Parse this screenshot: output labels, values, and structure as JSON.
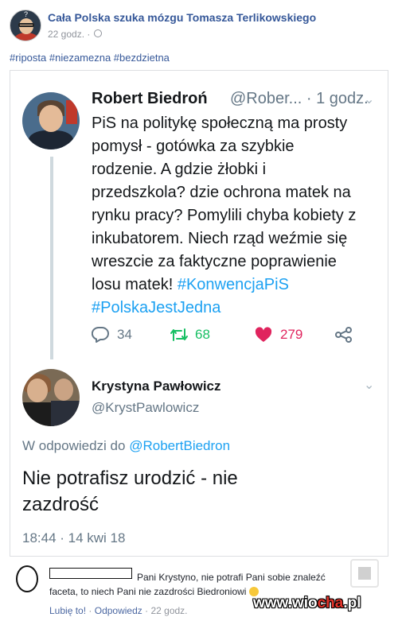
{
  "post": {
    "page_name": "Cała Polska szuka mózgu Tomasza Terlikowskiego",
    "time": "22 godz. ·",
    "hashtags": "#riposta #niezamezna #bezdzietna"
  },
  "tweet1": {
    "name": "Robert Biedroń",
    "handle": "@Rober... · 1 godz.",
    "text_lines": [
      "PiS na politykę społeczną ma prosty",
      "pomysł - gotówka za szybkie",
      "rodzenie. A gdzie żłobki i",
      "przedszkola? dzie ochrona matek na",
      "rynku pracy? Pomylili chyba kobiety z",
      "inkubatorem. Niech rząd weźmie się",
      "wreszcie za faktyczne poprawienie",
      "losu matek!"
    ],
    "hashtag1": "#KonwencjaPiS",
    "hashtag2": "#PolskaJestJedna",
    "replies": "34",
    "retweets": "68",
    "likes": "279",
    "colors": {
      "retweet": "#17bf63",
      "like": "#e0245e",
      "link": "#1da1f2"
    }
  },
  "tweet2": {
    "name": "Krystyna Pawłowicz",
    "handle": "@KrystPawlowicz",
    "reply_prefix": "W odpowiedzi do",
    "reply_mention": "@RobertBiedron",
    "text_line1": "Nie potrafisz urodzić - nie",
    "text_line2": "zazdrość",
    "date": "18:44 · 14 kwi 18"
  },
  "comment": {
    "text_line1": "Pani Krystyno, nie potrafi Pani sobie znaleźć",
    "text_line2": "faceta, to niech Pani nie zazdrości Biedroniowi",
    "like": "Lubię to!",
    "reply": "Odpowiedz",
    "time": "22 godz.",
    "sep": "·"
  },
  "watermark": {
    "prefix": "www.wio",
    "accent": "cha",
    "suffix": ".pl"
  }
}
